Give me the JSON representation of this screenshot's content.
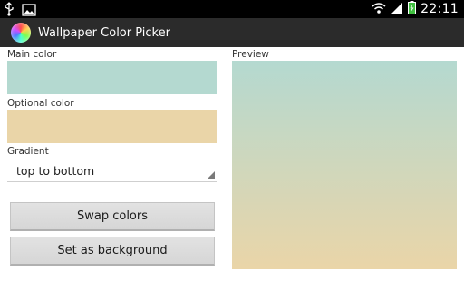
{
  "status_bar": {
    "time": "22:11",
    "icons": [
      "usb-icon",
      "image-icon",
      "wifi-icon",
      "signal-icon",
      "battery-icon"
    ]
  },
  "action_bar": {
    "title": "Wallpaper Color Picker",
    "icon": "color-wheel-icon"
  },
  "main_color": {
    "label": "Main color",
    "color": "#b4d9d0"
  },
  "optional_color": {
    "label": "Optional color",
    "color": "#ead5a8"
  },
  "gradient": {
    "label": "Gradient",
    "selected": "top to bottom"
  },
  "buttons": {
    "swap": "Swap colors",
    "set_background": "Set as background"
  },
  "preview": {
    "label": "Preview"
  }
}
